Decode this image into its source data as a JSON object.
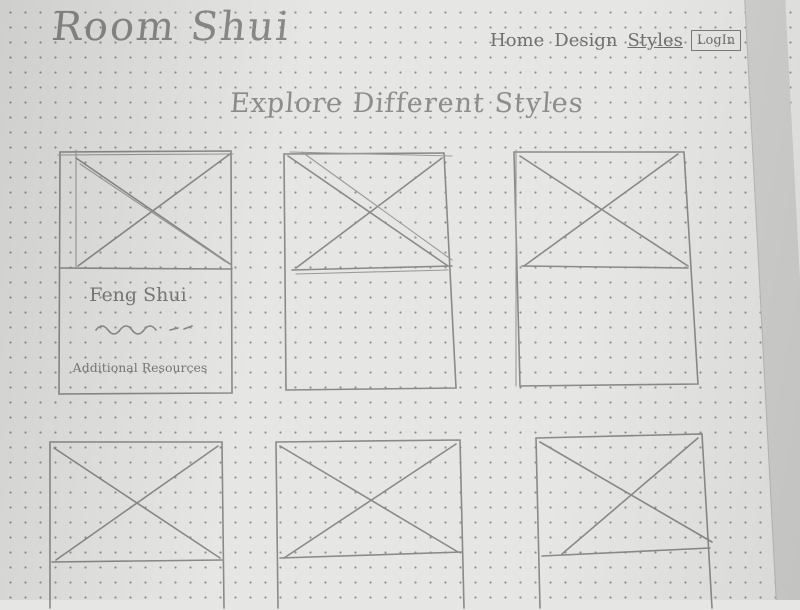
{
  "header": {
    "logo": "Room Shui",
    "nav": [
      {
        "label": "Home",
        "active": false
      },
      {
        "label": "Design",
        "active": false
      },
      {
        "label": "Styles",
        "active": true
      }
    ],
    "login_label": "LogIn"
  },
  "main": {
    "headline": "Explore Different Styles",
    "cards": [
      {
        "title": "Feng Shui",
        "link": "Additional Resources"
      },
      {
        "title": "",
        "link": ""
      },
      {
        "title": "",
        "link": ""
      },
      {
        "title": "",
        "link": ""
      },
      {
        "title": "",
        "link": ""
      },
      {
        "title": "",
        "link": ""
      }
    ]
  },
  "colors": {
    "pencil": "#8a8a8a",
    "paper": "#e6e6e4",
    "dots": "#8f8f8f"
  }
}
